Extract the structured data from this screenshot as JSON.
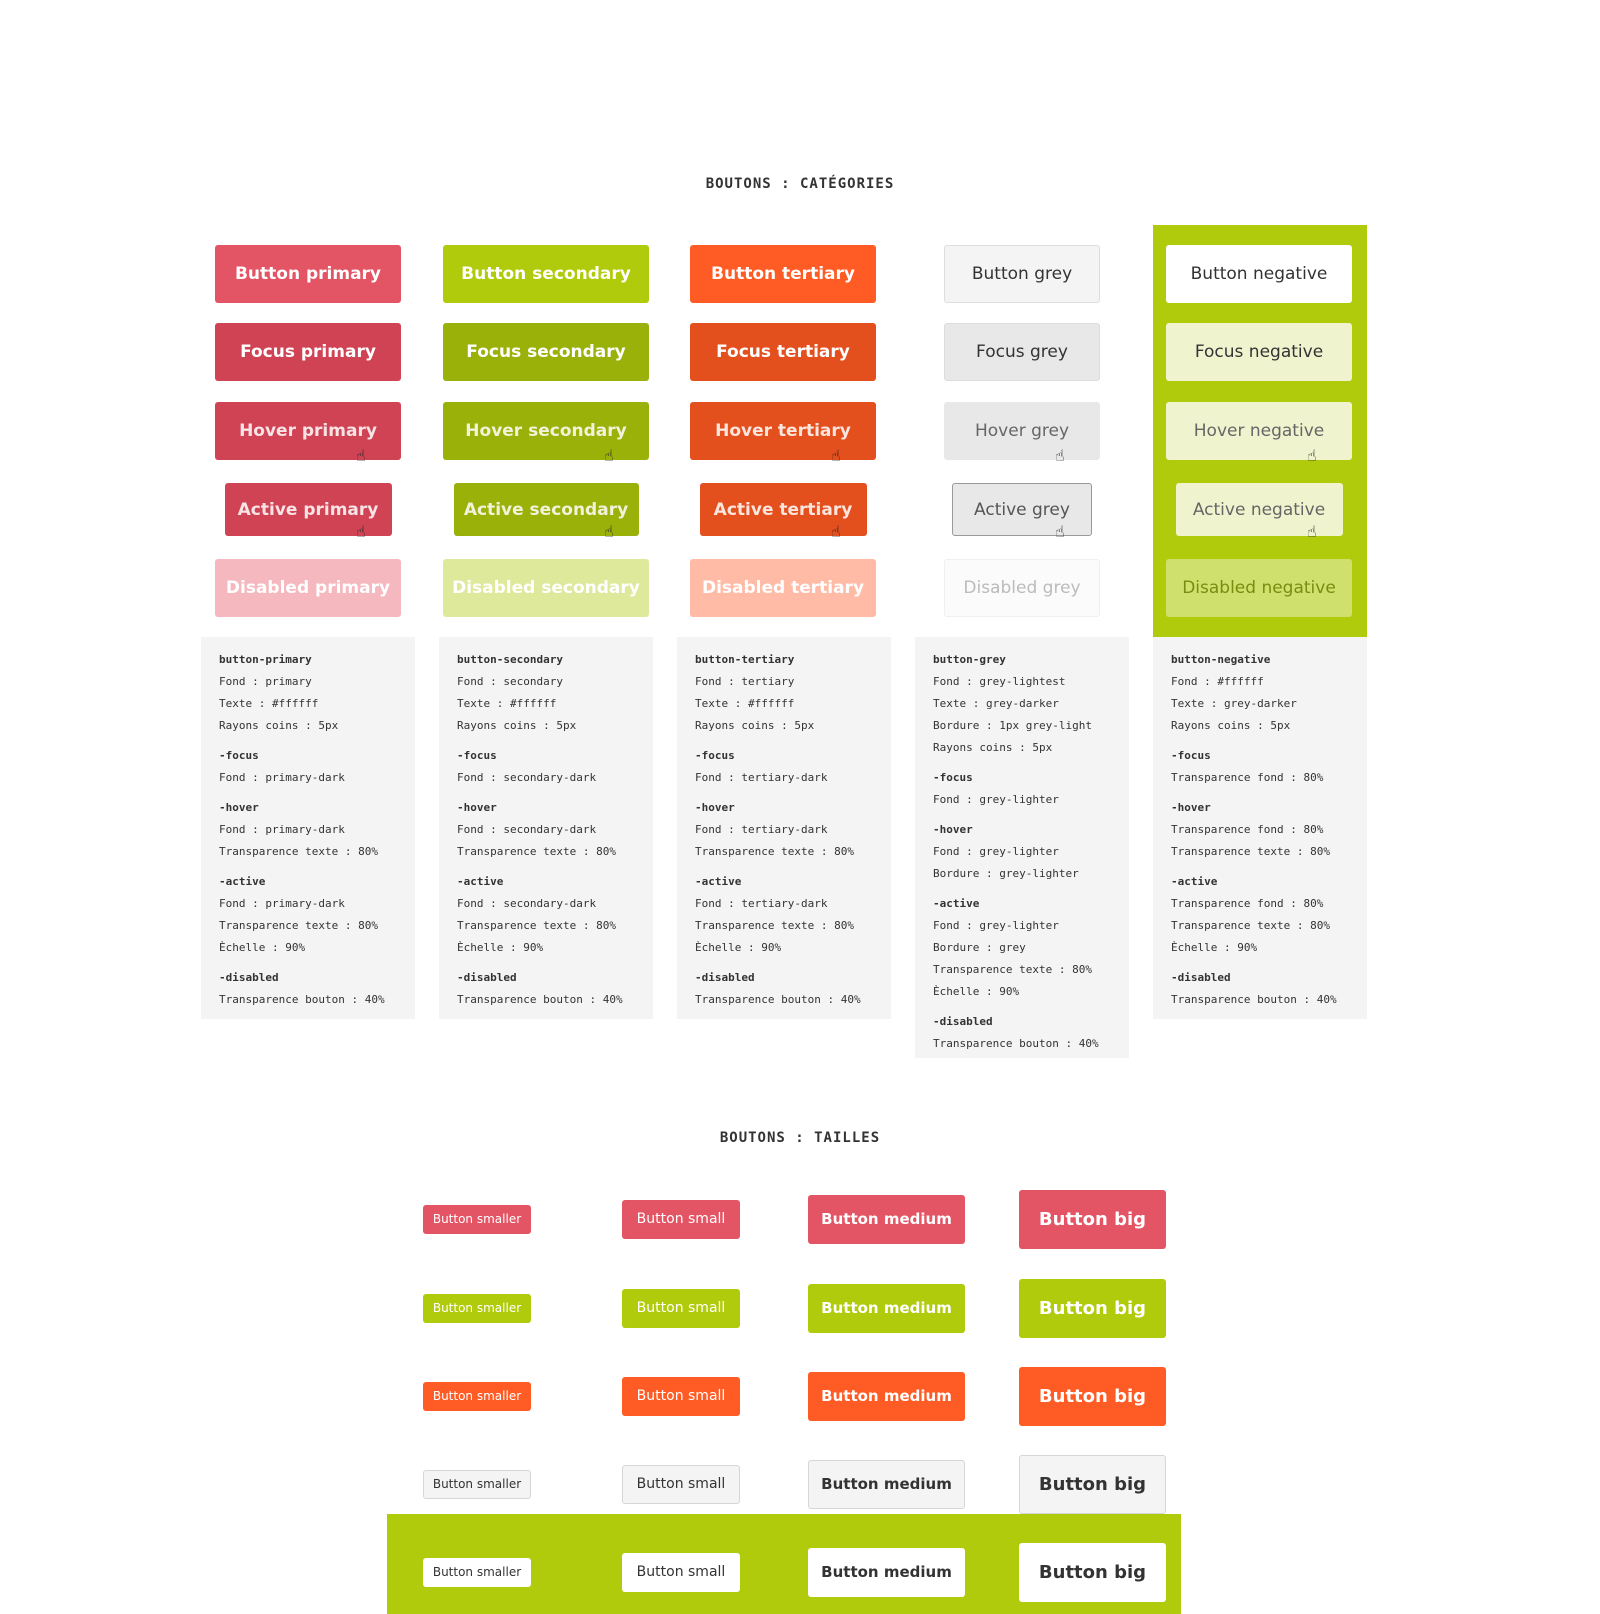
{
  "sections": {
    "categories": "BOUTONS : CATÉGORIES",
    "sizes": "BOUTONS : TAILLES"
  },
  "colors": {
    "primary": "#e35464",
    "primary_dark": "#cf4354",
    "secondary": "#b0cb0b",
    "secondary_dark": "#9ab10a",
    "tertiary": "#ff5b24",
    "tertiary_dark": "#e44f1e",
    "grey_lightest": "#f4f4f4",
    "grey_lighter": "#e8e8e8",
    "negative_panel": "#b0cb0b"
  },
  "columns": [
    {
      "id": "primary",
      "buttons": [
        "Button primary",
        "Focus primary",
        "Hover primary",
        "Active primary",
        "Disabled primary"
      ],
      "spec": [
        [
          "button-primary",
          "Fond : primary",
          "Texte : #ffffff",
          "Rayons coins : 5px"
        ],
        [
          "-focus",
          "Fond : primary-dark"
        ],
        [
          "-hover",
          "Fond : primary-dark",
          "Transparence texte : 80%"
        ],
        [
          "-active",
          "Fond : primary-dark",
          "Transparence texte : 80%",
          "Èchelle : 90%"
        ],
        [
          "-disabled",
          "Transparence bouton : 40%"
        ]
      ]
    },
    {
      "id": "secondary",
      "buttons": [
        "Button secondary",
        "Focus secondary",
        "Hover secondary",
        "Active secondary",
        "Disabled secondary"
      ],
      "spec": [
        [
          "button-secondary",
          "Fond : secondary",
          "Texte : #ffffff",
          "Rayons coins : 5px"
        ],
        [
          "-focus",
          "Fond : secondary-dark"
        ],
        [
          "-hover",
          "Fond : secondary-dark",
          "Transparence texte : 80%"
        ],
        [
          "-active",
          "Fond : secondary-dark",
          "Transparence texte : 80%",
          "Èchelle : 90%"
        ],
        [
          "-disabled",
          "Transparence bouton : 40%"
        ]
      ]
    },
    {
      "id": "tertiary",
      "buttons": [
        "Button tertiary",
        "Focus tertiary",
        "Hover tertiary",
        "Active tertiary",
        "Disabled tertiary"
      ],
      "spec": [
        [
          "button-tertiary",
          "Fond : tertiary",
          "Texte : #ffffff",
          "Rayons coins : 5px"
        ],
        [
          "-focus",
          "Fond : tertiary-dark"
        ],
        [
          "-hover",
          "Fond : tertiary-dark",
          "Transparence texte : 80%"
        ],
        [
          "-active",
          "Fond : tertiary-dark",
          "Transparence texte : 80%",
          "Èchelle : 90%"
        ],
        [
          "-disabled",
          "Transparence bouton : 40%"
        ]
      ]
    },
    {
      "id": "grey",
      "buttons": [
        "Button grey",
        "Focus grey",
        "Hover grey",
        "Active grey",
        "Disabled grey"
      ],
      "spec": [
        [
          "button-grey",
          "Fond : grey-lightest",
          "Texte : grey-darker",
          "Bordure : 1px grey-light",
          "Rayons coins : 5px"
        ],
        [
          "-focus",
          "Fond : grey-lighter"
        ],
        [
          "-hover",
          "Fond : grey-lighter",
          "Bordure : grey-lighter"
        ],
        [
          "-active",
          "Fond : grey-lighter",
          "Bordure : grey",
          "Transparence texte : 80%",
          "Èchelle : 90%"
        ],
        [
          "-disabled",
          "Transparence bouton : 40%"
        ]
      ]
    },
    {
      "id": "negative",
      "buttons": [
        "Button negative",
        "Focus negative",
        "Hover negative",
        "Active negative",
        "Disabled negative"
      ],
      "spec": [
        [
          "button-negative",
          "Fond : #ffffff",
          "Texte : grey-darker",
          "Rayons coins : 5px"
        ],
        [
          "-focus",
          "Transparence fond : 80%"
        ],
        [
          "-hover",
          "Transparence fond : 80%",
          "Transparence texte : 80%"
        ],
        [
          "-active",
          "Transparence fond : 80%",
          "Transparence texte : 80%",
          "Èchelle : 90%"
        ],
        [
          "-disabled",
          "Transparence bouton : 40%"
        ]
      ]
    }
  ],
  "sizes": {
    "labels": [
      "Button smaller",
      "Button small",
      "Button medium",
      "Button big"
    ],
    "rows": [
      "primary",
      "secondary",
      "tertiary",
      "grey",
      "negative"
    ]
  }
}
